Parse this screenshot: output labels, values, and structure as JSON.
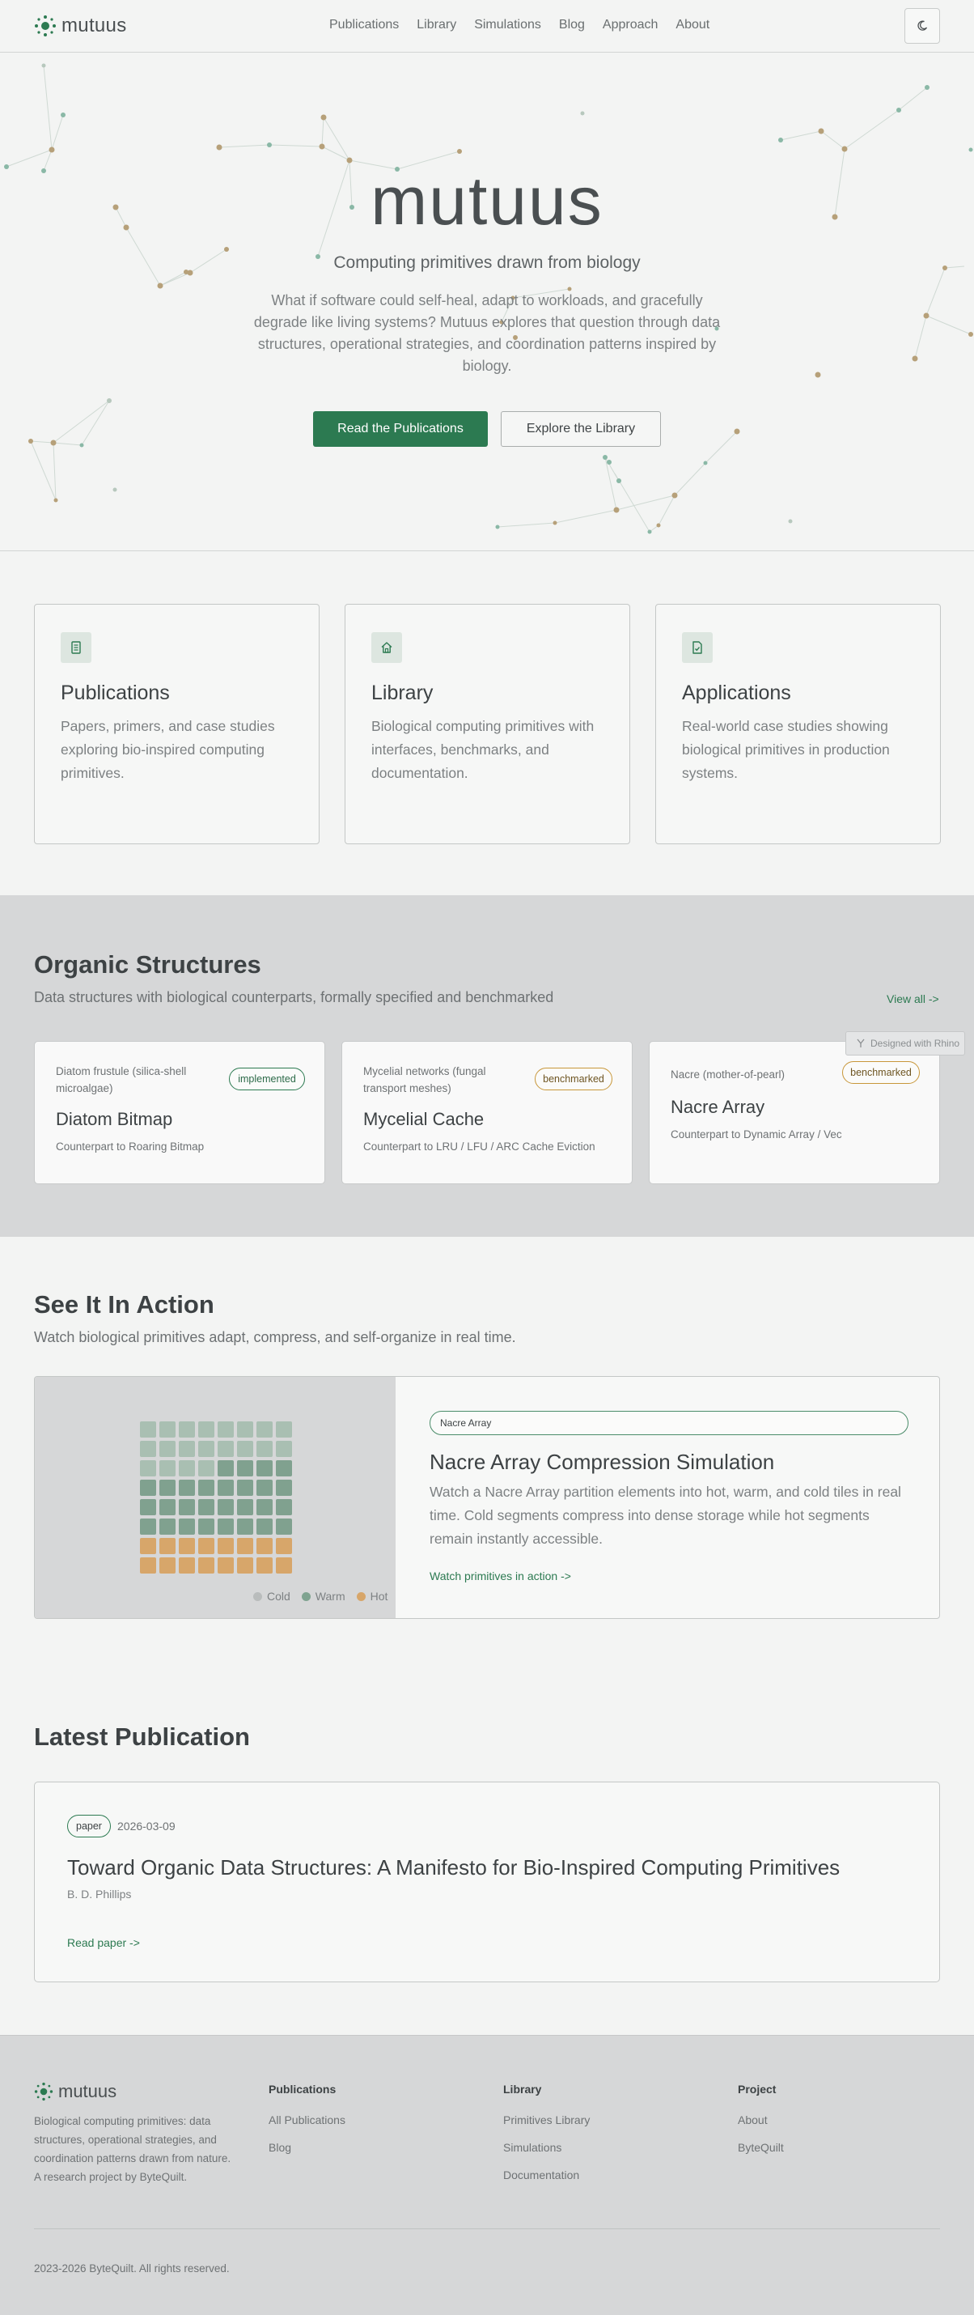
{
  "brand": {
    "name": "mutuus",
    "accent": "#2c7a51"
  },
  "nav": {
    "links": [
      "Publications",
      "Library",
      "Simulations",
      "Blog",
      "Approach",
      "About"
    ],
    "theme_toggle_icon": "moon-icon"
  },
  "hero": {
    "wordmark": "mutuus",
    "tagline": "Computing primitives drawn from biology",
    "description": "What if software could self-heal, adapt to workloads, and gracefully degrade like living systems? Mutuus explores that question through data structures, operational strategies, and coordination patterns inspired by biology.",
    "primary_button": "Read the Publications",
    "secondary_button": "Explore the Library"
  },
  "features": [
    {
      "icon": "document-icon",
      "title": "Publications",
      "description": "Papers, primers, and case studies exploring bio-inspired computing primitives."
    },
    {
      "icon": "home-icon",
      "title": "Library",
      "description": "Biological computing primitives with interfaces, benchmarks, and documentation."
    },
    {
      "icon": "file-check-icon",
      "title": "Applications",
      "description": "Real-world case studies showing biological primitives in production systems."
    }
  ],
  "structures": {
    "title": "Organic Structures",
    "subtitle": "Data structures with biological counterparts, formally specified and benchmarked",
    "view_all": "View all ->",
    "rhino_badge": "Designed with Rhino",
    "cards": [
      {
        "bio": "Diatom frustule (silica-shell microalgae)",
        "name": "Diatom Bitmap",
        "counterpart": "Counterpart to Roaring Bitmap",
        "status": "implemented"
      },
      {
        "bio": "Mycelial networks (fungal transport meshes)",
        "name": "Mycelial Cache",
        "counterpart": "Counterpart to LRU / LFU / ARC Cache Eviction",
        "status": "benchmarked"
      },
      {
        "bio": "Nacre (mother-of-pearl)",
        "name": "Nacre Array",
        "counterpart": "Counterpart to Dynamic Array / Vec",
        "status": "benchmarked"
      }
    ]
  },
  "action": {
    "title": "See It In Action",
    "subtitle": "Watch biological primitives adapt, compress, and self-organize in real time.",
    "sim_label": "Nacre Array",
    "sim_title": "Nacre Array Compression Simulation",
    "sim_description": "Watch a Nacre Array partition elements into hot, warm, and cold tiles in real time. Cold segments compress into dense storage while hot segments remain instantly accessible.",
    "sim_link": "Watch primitives in action ->",
    "legend": [
      {
        "label": "Cold",
        "color": "#b9bcbc"
      },
      {
        "label": "Warm",
        "color": "#7fa390"
      },
      {
        "label": "Hot",
        "color": "#d7a66a"
      }
    ],
    "tile_rows": [
      [
        "c",
        "c",
        "c",
        "c",
        "c",
        "c",
        "c",
        "c"
      ],
      [
        "c",
        "c",
        "c",
        "c",
        "c",
        "c",
        "c",
        "c"
      ],
      [
        "c",
        "c",
        "c",
        "c",
        "w",
        "w",
        "w",
        "w"
      ],
      [
        "w",
        "w",
        "w",
        "w",
        "w",
        "w",
        "w",
        "w"
      ],
      [
        "w",
        "w",
        "w",
        "w",
        "w",
        "w",
        "w",
        "w"
      ],
      [
        "w",
        "w",
        "w",
        "w",
        "w",
        "w",
        "w",
        "w"
      ],
      [
        "h",
        "h",
        "h",
        "h",
        "h",
        "h",
        "h",
        "h"
      ],
      [
        "h",
        "h",
        "h",
        "h",
        "h",
        "h",
        "h",
        "h"
      ]
    ],
    "tile_colors": {
      "c": "#a9bfb2",
      "w": "#80a18f",
      "h": "#d7a66a"
    }
  },
  "latest": {
    "title": "Latest Publication",
    "badge": "paper",
    "date": "2026-03-09",
    "pub_title": "Toward Organic Data Structures: A Manifesto for Bio-Inspired Computing Primitives",
    "author": "B. D. Phillips",
    "link": "Read paper ->"
  },
  "footer": {
    "description": "Biological computing primitives: data structures, operational strategies, and coordination patterns drawn from nature. A research project by ByteQuilt.",
    "columns": [
      {
        "heading": "Publications",
        "links": [
          "All Publications",
          "Blog"
        ]
      },
      {
        "heading": "Library",
        "links": [
          "Primitives Library",
          "Simulations",
          "Documentation"
        ]
      },
      {
        "heading": "Project",
        "links": [
          "About",
          "ByteQuilt"
        ]
      }
    ],
    "copyright": "2023-2026 ByteQuilt. All rights reserved."
  }
}
